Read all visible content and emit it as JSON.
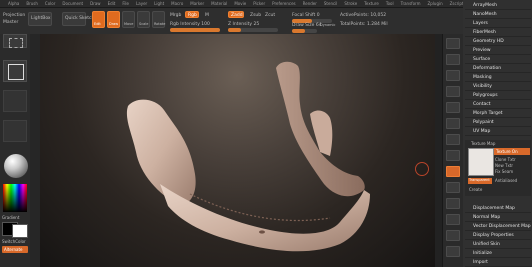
{
  "menubar": [
    "Alpha",
    "Brush",
    "Color",
    "Document",
    "Draw",
    "Edit",
    "File",
    "Layer",
    "Light",
    "Macro",
    "Marker",
    "Material",
    "Movie",
    "Picker",
    "Preferences",
    "Render",
    "Stencil",
    "Stroke",
    "Texture",
    "Tool",
    "Transform",
    "Zplugin",
    "Zscript"
  ],
  "toolbar": {
    "projection_label": "Projection",
    "master_label": "Master",
    "lightbox_label": "LightBox",
    "quick_sketch_label": "Quick Sketch",
    "edit_label": "Edit",
    "draw_label": "Draw",
    "move_label": "Move",
    "scale_label": "Scale",
    "rotate_label": "Rotate",
    "mrgb_label": "Mrgb",
    "rgb_label": "Rgb",
    "m_label": "M",
    "zadd_label": "Zadd",
    "zsub_label": "Zsub",
    "zcut_label": "Zcut",
    "rgb_intensity_label": "Rgb Intensity 100",
    "z_intensity_label": "Z Intensity 25",
    "focal_shift_label": "Focal Shift 0",
    "draw_size_label": "Draw Size 64",
    "dynamic_label": "Dynamic",
    "active_points_label": "ActivePoints: 10,052",
    "total_points_label": "TotalPoints: 1.284 Mil"
  },
  "leftshelf": {
    "gradient_label": "Gradient",
    "switch_color_label": "SwitchColor",
    "alternate_label": "Alternate"
  },
  "righttools": 14,
  "panel": {
    "items": [
      "ArrayMesh",
      "NanoMesh",
      "Layers",
      "FiberMesh",
      "Geometry HD",
      "Preview",
      "Surface",
      "Deformation",
      "Masking",
      "Visibility",
      "Polygroups",
      "Contact",
      "Morph Target",
      "Polypaint",
      "UV Map"
    ],
    "texture_map_label": "Texture Map",
    "texture_on_label": "Texture On",
    "sub_items": [
      "Clone Txtr",
      "New Txtr",
      "Fix Seam"
    ],
    "transparent_label": "Transparent",
    "antialiased_label": "Antialiased",
    "create_label": "Create",
    "items2": [
      "Displacement Map",
      "Normal Map",
      "Vector Displacement Map",
      "Display Properties",
      "Unified Skin",
      "Initialize",
      "Import"
    ]
  }
}
